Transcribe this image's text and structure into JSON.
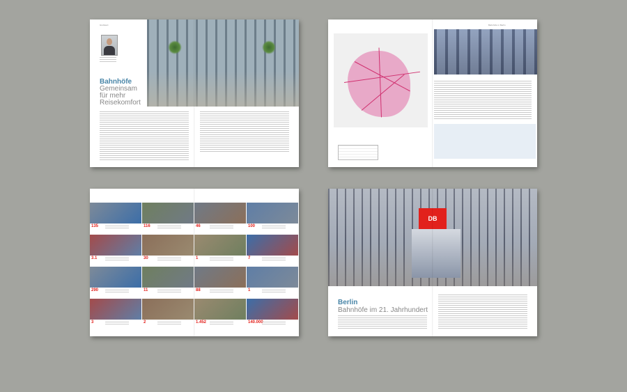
{
  "spread1": {
    "runhead_left": "Grußwort",
    "title_line1": "Bahnhöfe",
    "title_line2": "Gemeinsam",
    "title_line3": "für mehr",
    "title_line4": "Reisekomfort"
  },
  "spread2": {
    "runhead_right": "Bahnhöfe in Berlin"
  },
  "spread3": {
    "numbers": [
      "135",
      "116",
      "46",
      "100",
      "3.1",
      "30",
      "1",
      "7",
      "290",
      "11",
      "88",
      "1",
      "3",
      "2",
      "1.452",
      "140.000"
    ]
  },
  "spread4": {
    "sign": "DB",
    "title_line1": "Berlin",
    "title_line2": "Bahnhöfe im 21. Jahrhundert"
  },
  "colors": {
    "background": "#a3a49f",
    "accent_red": "#e2211c",
    "title_blue": "#4a86a8",
    "map_pink": "#e8a9c8"
  }
}
